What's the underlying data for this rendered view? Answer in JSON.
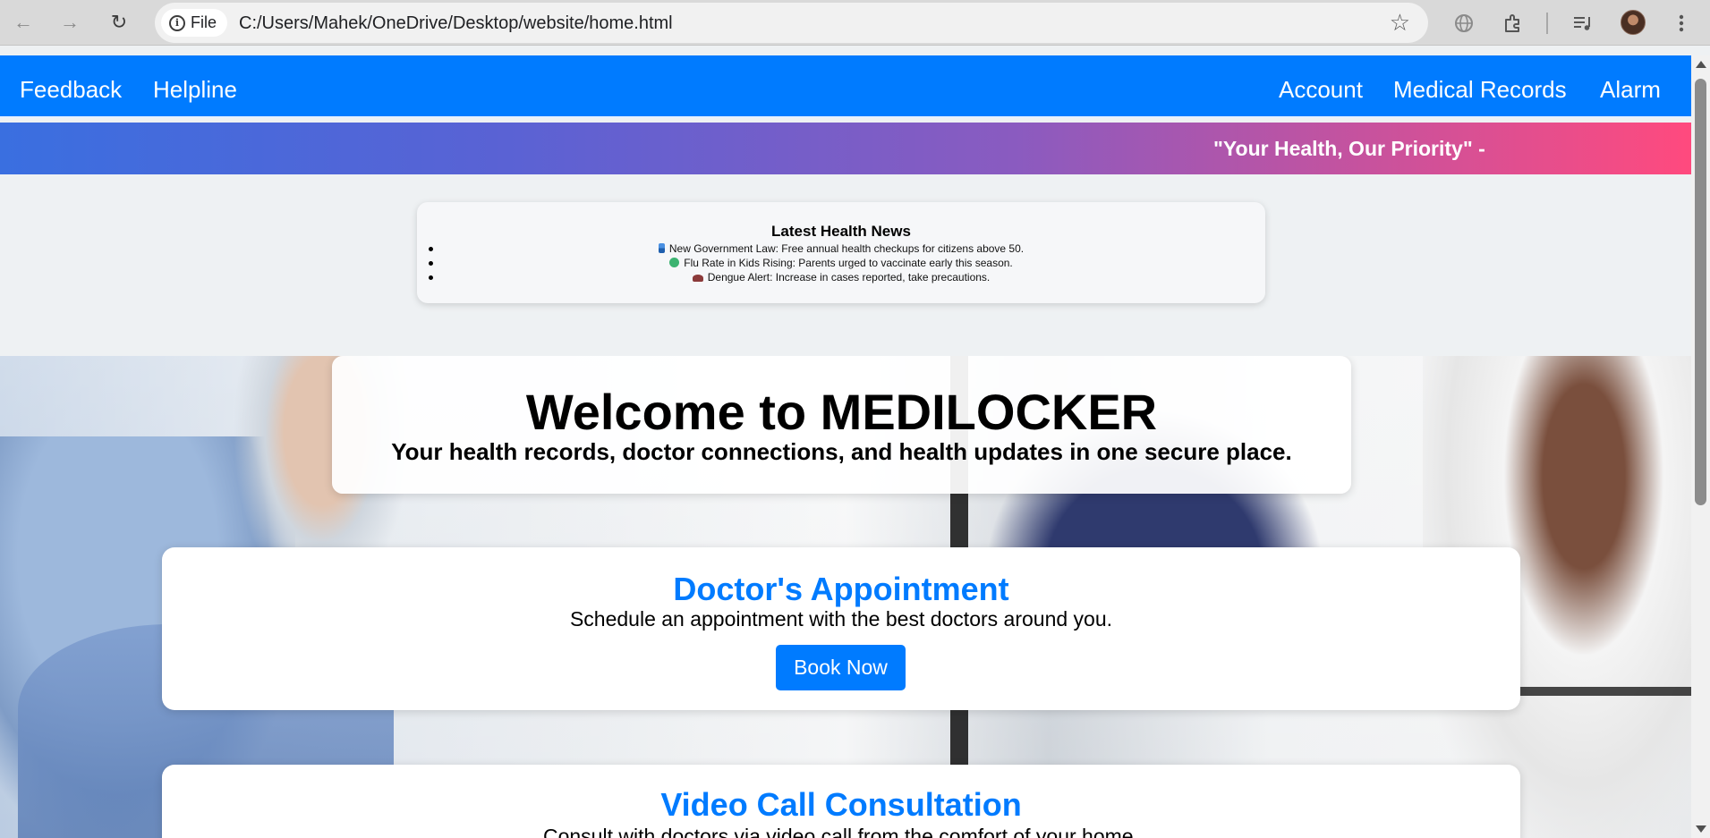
{
  "browser": {
    "site_chip_label": "File",
    "url": "C:/Users/Mahek/OneDrive/Desktop/website/home.html",
    "icons": [
      "back-icon",
      "forward-icon",
      "reload-icon",
      "info-icon",
      "star-icon",
      "translate-icon",
      "extensions-icon",
      "media-icon",
      "profile-avatar",
      "menu-icon"
    ]
  },
  "nav": {
    "left": [
      "Feedback",
      "Helpline"
    ],
    "right": [
      "Account",
      "Medical Records",
      "Alarm"
    ]
  },
  "marquee": {
    "text": "\"Your Health, Our Priority\" -"
  },
  "news": {
    "title": "Latest Health News",
    "items": [
      "New Government Law: Free annual health checkups for citizens above 50.",
      "Flu Rate in Kids Rising: Parents urged to vaccinate early this season.",
      "Dengue Alert: Increase in cases reported, take precautions."
    ],
    "item_icons": [
      "pin-icon",
      "virus-icon",
      "mosquito-icon"
    ]
  },
  "welcome": {
    "title": "Welcome to MEDILOCKER",
    "subtitle": "Your health records, doctor connections, and health updates in one secure place."
  },
  "services": [
    {
      "title": "Doctor's Appointment",
      "description": "Schedule an appointment with the best doctors around you.",
      "button": "Book Now"
    },
    {
      "title": "Video Call Consultation",
      "description": "Consult with doctors via video call from the comfort of your home."
    }
  ],
  "colors": {
    "primary": "#007bff",
    "marquee_start": "#3a6fe0",
    "marquee_end": "#ff4a7e",
    "page_bg": "#eef1f3"
  }
}
